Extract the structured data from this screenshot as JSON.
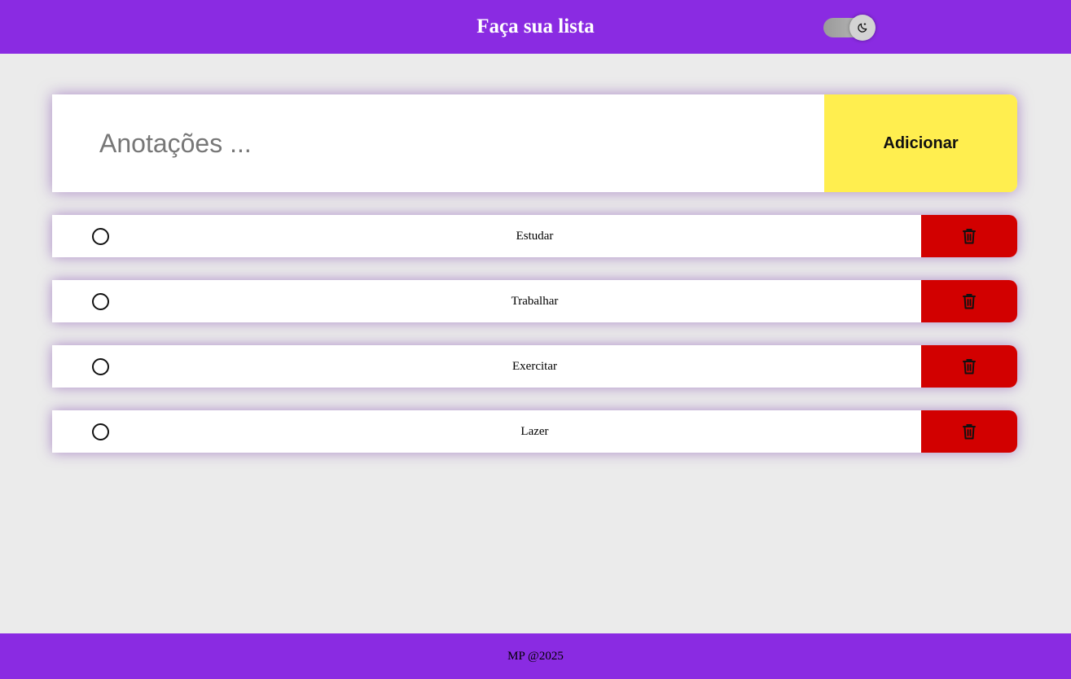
{
  "header": {
    "title": "Faça sua lista",
    "theme_toggle_icon": "moon-icon"
  },
  "form": {
    "input_placeholder": "Anotações ...",
    "input_value": "",
    "add_label": "Adicionar"
  },
  "tasks": [
    {
      "label": "Estudar",
      "done": false
    },
    {
      "label": "Trabalhar",
      "done": false
    },
    {
      "label": "Exercitar",
      "done": false
    },
    {
      "label": "Lazer",
      "done": false
    }
  ],
  "footer": {
    "text": "MP @2025"
  },
  "colors": {
    "header_bg": "#8a2be2",
    "page_bg": "#ebebeb",
    "add_button_bg": "#ffee4f",
    "delete_button_bg": "#d20000"
  }
}
